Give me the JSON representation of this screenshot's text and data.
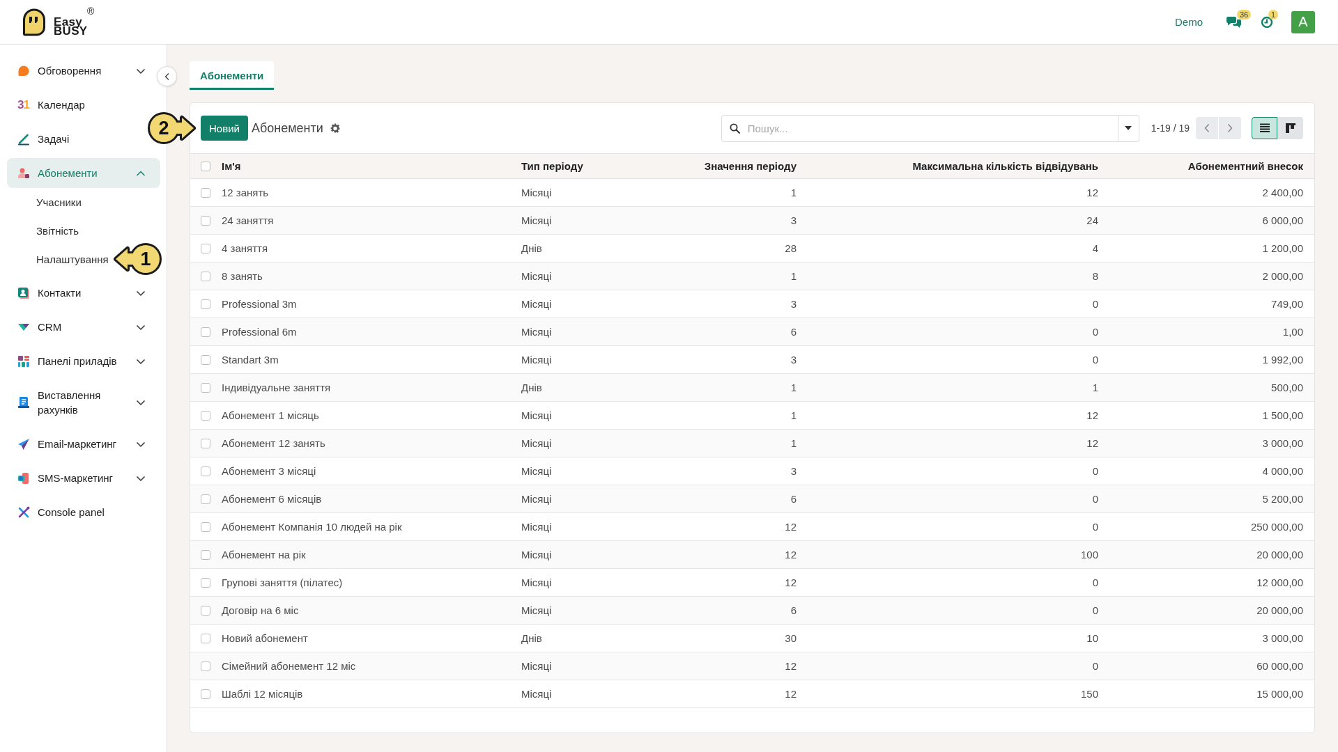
{
  "topbar": {
    "logo": {
      "line1": "Easy",
      "line2": "BUSY",
      "mark": "®"
    },
    "user_label": "Demo",
    "messages_badge": "36",
    "activities_badge": "1",
    "avatar": "A"
  },
  "sidebar": {
    "items": [
      {
        "label": "Обговорення",
        "kind": "group",
        "expanded": false,
        "selected": false
      },
      {
        "label": "Календар",
        "kind": "link",
        "selected": false,
        "glyph": "31"
      },
      {
        "label": "Задачі",
        "kind": "link",
        "selected": false
      },
      {
        "label": "Абонементи",
        "kind": "group",
        "expanded": true,
        "selected": true,
        "children": [
          {
            "label": "Учасники",
            "selected": false
          },
          {
            "label": "Звітність",
            "selected": false
          },
          {
            "label": "Налаштування",
            "selected": false,
            "callout": "1"
          }
        ]
      },
      {
        "label": "Контакти",
        "kind": "group",
        "expanded": false,
        "selected": false
      },
      {
        "label": "CRM",
        "kind": "group",
        "expanded": false,
        "selected": false
      },
      {
        "label": "Панелі приладів",
        "kind": "group",
        "expanded": false,
        "selected": false
      },
      {
        "label": "Виставлення рахунків",
        "kind": "group",
        "expanded": false,
        "selected": false
      },
      {
        "label": "Email-маркетинг",
        "kind": "group",
        "expanded": false,
        "selected": false
      },
      {
        "label": "SMS-маркетинг",
        "kind": "group",
        "expanded": false,
        "selected": false
      },
      {
        "label": "Console panel",
        "kind": "link",
        "selected": false
      }
    ]
  },
  "tabs": [
    {
      "label": "Абонементи",
      "selected": true
    }
  ],
  "toolbar": {
    "new_button": "Новий",
    "title": "Абонементи",
    "callout": "2",
    "search": {
      "placeholder": "Пошук..."
    },
    "pager": "1-19 / 19",
    "view_modes": [
      {
        "selected": true
      },
      {
        "selected": false
      }
    ]
  },
  "table": {
    "all_selected": false,
    "columns": [
      "Ім'я",
      "Тип періоду",
      "Значення періоду",
      "Максимальна кількість відвідувань",
      "Абонементний внесок"
    ],
    "rows": [
      {
        "cells": [
          "12 занять",
          "Місяці",
          "1",
          "12",
          "2 400,00"
        ],
        "selected": false
      },
      {
        "cells": [
          "24 заняття",
          "Місяці",
          "3",
          "24",
          "6 000,00"
        ],
        "selected": false
      },
      {
        "cells": [
          "4 заняття",
          "Днів",
          "28",
          "4",
          "1 200,00"
        ],
        "selected": false
      },
      {
        "cells": [
          "8 занять",
          "Місяці",
          "1",
          "8",
          "2 000,00"
        ],
        "selected": false
      },
      {
        "cells": [
          "Professional 3m",
          "Місяці",
          "3",
          "0",
          "749,00"
        ],
        "selected": false
      },
      {
        "cells": [
          "Professional 6m",
          "Місяці",
          "6",
          "0",
          "1,00"
        ],
        "selected": false
      },
      {
        "cells": [
          "Standart 3m",
          "Місяці",
          "3",
          "0",
          "1 992,00"
        ],
        "selected": false
      },
      {
        "cells": [
          "Індивідуальне заняття",
          "Днів",
          "1",
          "1",
          "500,00"
        ],
        "selected": false
      },
      {
        "cells": [
          "Абонемент 1 місяць",
          "Місяці",
          "1",
          "12",
          "1 500,00"
        ],
        "selected": false
      },
      {
        "cells": [
          "Абонемент 12 занять",
          "Місяці",
          "1",
          "12",
          "3 000,00"
        ],
        "selected": false
      },
      {
        "cells": [
          "Абонемент 3 місяці",
          "Місяці",
          "3",
          "0",
          "4 000,00"
        ],
        "selected": false
      },
      {
        "cells": [
          "Абонемент 6 місяців",
          "Місяці",
          "6",
          "0",
          "5 200,00"
        ],
        "selected": false
      },
      {
        "cells": [
          "Абонемент Компанія 10 людей на рік",
          "Місяці",
          "12",
          "0",
          "250 000,00"
        ],
        "selected": false
      },
      {
        "cells": [
          "Абонемент на рік",
          "Місяці",
          "12",
          "100",
          "20 000,00"
        ],
        "selected": false
      },
      {
        "cells": [
          "Групові заняття (пілатес)",
          "Місяці",
          "12",
          "0",
          "12 000,00"
        ],
        "selected": false
      },
      {
        "cells": [
          "Договір на 6 міс",
          "Місяці",
          "6",
          "0",
          "20 000,00"
        ],
        "selected": false
      },
      {
        "cells": [
          "Новий абонемент",
          "Днів",
          "30",
          "10",
          "3 000,00"
        ],
        "selected": false
      },
      {
        "cells": [
          "Сімейний абонемент 12 міс",
          "Місяці",
          "12",
          "0",
          "60 000,00"
        ],
        "selected": false
      },
      {
        "cells": [
          "Шаблі 12 місяців",
          "Місяці",
          "12",
          "150",
          "15 000,00"
        ],
        "selected": false
      }
    ]
  }
}
